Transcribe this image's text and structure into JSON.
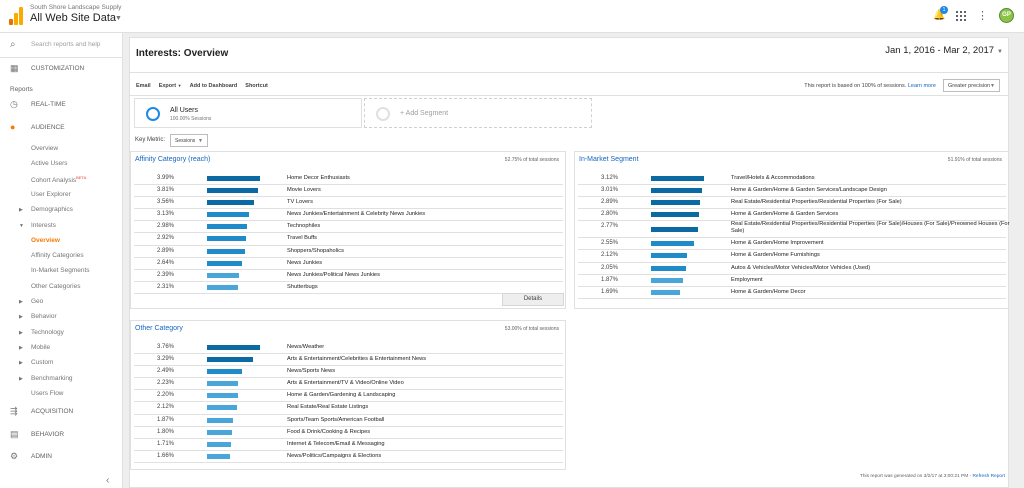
{
  "header": {
    "account_name": "South Shore Landscape Supply",
    "property_name": "All Web Site Data",
    "notification_count": "1",
    "avatar_initials": "GP",
    "brand_color": "#f9ab00"
  },
  "sidebar": {
    "search_placeholder": "Search reports and help",
    "customization": "CUSTOMIZATION",
    "reports_label": "Reports",
    "realtime": "REAL-TIME",
    "audience": "AUDIENCE",
    "audience_items": [
      "Overview",
      "Active Users",
      "Cohort Analysis",
      "User Explorer",
      "Demographics",
      "Interests",
      "Overview",
      "Affinity Categories",
      "In-Market Segments",
      "Other Categories",
      "Geo",
      "Behavior",
      "Technology",
      "Mobile",
      "Custom",
      "Benchmarking",
      "Users Flow"
    ],
    "beta_label": "BETA",
    "acquisition": "ACQUISITION",
    "behavior": "BEHAVIOR",
    "admin": "ADMIN"
  },
  "page": {
    "title": "Interests: Overview",
    "date_range": "Jan 1, 2016 - Mar 2, 2017",
    "toolbar": [
      "Email",
      "Export",
      "Add to Dashboard",
      "Shortcut"
    ],
    "report_note": "This report is based on 100% of sessions.",
    "learn_more": "Learn more",
    "precision": "Greater precision",
    "segment_name": "All Users",
    "segment_sub": "100.00% Sessions",
    "add_segment": "+ Add Segment",
    "key_metric_label": "Key Metric:",
    "key_metric_value": "Sessions",
    "details_button": "Details",
    "footer_note": "This report was generated on 3/2/17 at 3:00:21 PM -",
    "refresh": "Refresh Report"
  },
  "affinity": {
    "title": "Affinity Category (reach)",
    "pct_label": "52.75% of total sessions",
    "rows": [
      {
        "value": "3.99%",
        "label": "Home Decor Enthusiasts",
        "num": 3.99
      },
      {
        "value": "3.81%",
        "label": "Movie Lovers",
        "num": 3.81
      },
      {
        "value": "3.56%",
        "label": "TV Lovers",
        "num": 3.56
      },
      {
        "value": "3.13%",
        "label": "News Junkies/Entertainment & Celebrity News Junkies",
        "num": 3.13
      },
      {
        "value": "2.98%",
        "label": "Technophiles",
        "num": 2.98
      },
      {
        "value": "2.92%",
        "label": "Travel Buffs",
        "num": 2.92
      },
      {
        "value": "2.89%",
        "label": "Shoppers/Shopaholics",
        "num": 2.89
      },
      {
        "value": "2.64%",
        "label": "News Junkies",
        "num": 2.64
      },
      {
        "value": "2.39%",
        "label": "News Junkies/Political News Junkies",
        "num": 2.39
      },
      {
        "value": "2.31%",
        "label": "Shutterbugs",
        "num": 2.31
      }
    ]
  },
  "inmarket": {
    "title": "In-Market Segment",
    "pct_label": "51.91% of total sessions",
    "rows": [
      {
        "value": "3.12%",
        "label": "Travel/Hotels & Accommodations",
        "num": 3.12
      },
      {
        "value": "3.01%",
        "label": "Home & Garden/Home & Garden Services/Landscape Design",
        "num": 3.01
      },
      {
        "value": "2.89%",
        "label": "Real Estate/Residential Properties/Residential Properties (For Sale)",
        "num": 2.89
      },
      {
        "value": "2.80%",
        "label": "Home & Garden/Home & Garden Services",
        "num": 2.8
      },
      {
        "value": "2.77%",
        "label": "Real Estate/Residential Properties/Residential Properties (For Sale)/Houses (For Sale)/Preowned Houses (For Sale)",
        "num": 2.77
      },
      {
        "value": "2.55%",
        "label": "Home & Garden/Home Improvement",
        "num": 2.55
      },
      {
        "value": "2.12%",
        "label": "Home & Garden/Home Furnishings",
        "num": 2.12
      },
      {
        "value": "2.05%",
        "label": "Autos & Vehicles/Motor Vehicles/Motor Vehicles (Used)",
        "num": 2.05
      },
      {
        "value": "1.87%",
        "label": "Employment",
        "num": 1.87
      },
      {
        "value": "1.69%",
        "label": "Home & Garden/Home Decor",
        "num": 1.69
      }
    ]
  },
  "other": {
    "title": "Other Category",
    "pct_label": "53.00% of total sessions",
    "rows": [
      {
        "value": "3.76%",
        "label": "News/Weather",
        "num": 3.76
      },
      {
        "value": "3.29%",
        "label": "Arts & Entertainment/Celebrities & Entertainment News",
        "num": 3.29
      },
      {
        "value": "2.49%",
        "label": "News/Sports News",
        "num": 2.49
      },
      {
        "value": "2.23%",
        "label": "Arts & Entertainment/TV & Video/Online Video",
        "num": 2.23
      },
      {
        "value": "2.20%",
        "label": "Home & Garden/Gardening & Landscaping",
        "num": 2.2
      },
      {
        "value": "2.12%",
        "label": "Real Estate/Real Estate Listings",
        "num": 2.12
      },
      {
        "value": "1.87%",
        "label": "Sports/Team Sports/American Football",
        "num": 1.87
      },
      {
        "value": "1.80%",
        "label": "Food & Drink/Cooking & Recipes",
        "num": 1.8
      },
      {
        "value": "1.71%",
        "label": "Internet & Telecom/Email & Messaging",
        "num": 1.71
      },
      {
        "value": "1.66%",
        "label": "News/Politics/Campaigns & Elections",
        "num": 1.66
      }
    ]
  },
  "colors": {
    "bar_dark": "#0b6aa2",
    "bar_mid": "#1f8bc9",
    "bar_light": "#4aa6d9",
    "accent_orange": "#f57c00",
    "link_blue": "#1565c0"
  }
}
